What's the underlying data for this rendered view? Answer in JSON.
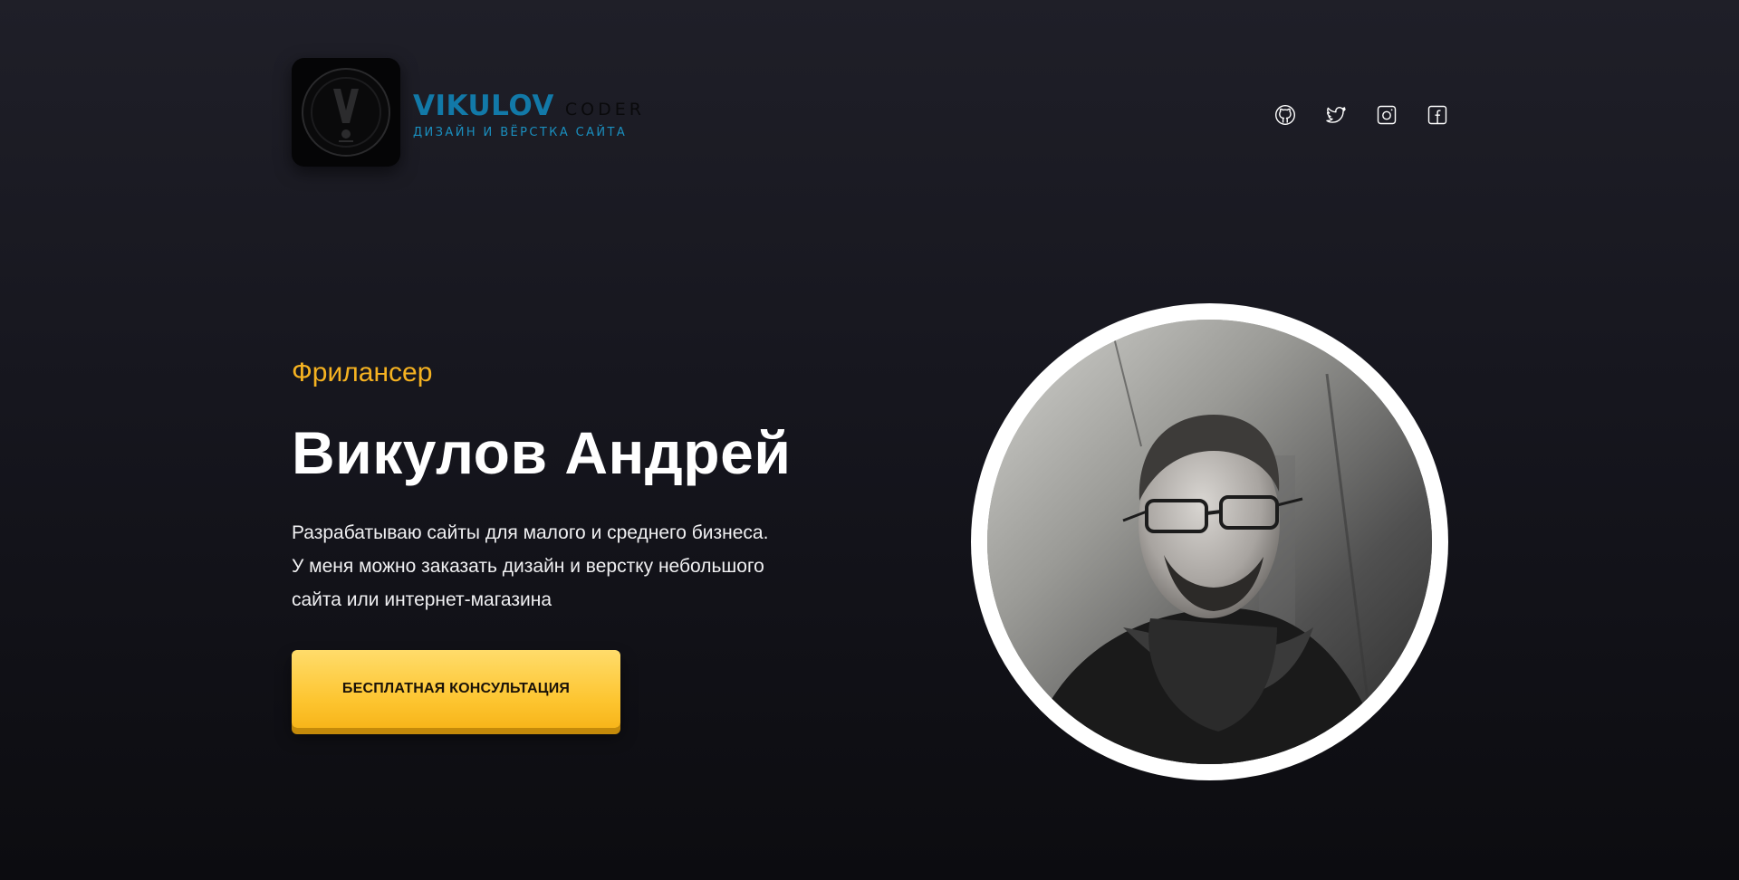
{
  "header": {
    "logo_name": "VIKULOV",
    "logo_suffix": "CODER",
    "logo_tagline": "ДИЗАЙН И ВЁРСТКА САЙТА",
    "socials": [
      {
        "icon": "github-icon"
      },
      {
        "icon": "twitter-icon"
      },
      {
        "icon": "instagram-icon"
      },
      {
        "icon": "facebook-icon"
      }
    ]
  },
  "hero": {
    "eyebrow": "Фрилансер",
    "name": "Викулов Андрей",
    "description_lines": [
      "Разрабатываю сайты для малого и среднего бизнеса.",
      "У меня можно заказать дизайн и верстку небольшого",
      "сайта или интернет-магазина"
    ],
    "cta_label": "БЕСПЛАТНАЯ КОНСУЛЬТАЦИЯ"
  },
  "colors": {
    "accent": "#f5b221",
    "brand_blue": "#1279a8",
    "button": "#fdc530",
    "background": "#16161e"
  }
}
